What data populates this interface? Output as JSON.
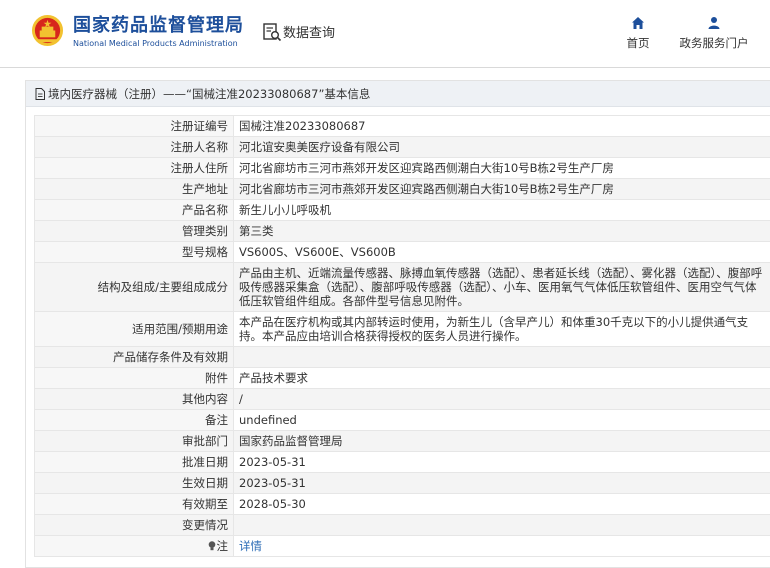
{
  "header": {
    "brand_cn": "国家药品监督管理局",
    "brand_en": "National Medical Products Administration",
    "query_label": "数据查询",
    "nav_home": "首页",
    "nav_portal": "政务服务门户",
    "brand_color": "#1d4f9b"
  },
  "breadcrumb": {
    "text": "境内医疗器械（注册）——“国械注准20233080687”基本信息"
  },
  "rows": [
    {
      "label": "注册证编号",
      "value": "国械注准20233080687"
    },
    {
      "label": "注册人名称",
      "value": "河北谊安奥美医疗设备有限公司"
    },
    {
      "label": "注册人住所",
      "value": "河北省廊坊市三河市燕郊开发区迎宾路西侧潮白大街10号B栋2号生产厂房"
    },
    {
      "label": "生产地址",
      "value": "河北省廊坊市三河市燕郊开发区迎宾路西侧潮白大街10号B栋2号生产厂房"
    },
    {
      "label": "产品名称",
      "value": "新生儿小儿呼吸机"
    },
    {
      "label": "管理类别",
      "value": "第三类"
    },
    {
      "label": "型号规格",
      "value": "VS600S、VS600E、VS600B"
    },
    {
      "label": "结构及组成/主要组成成分",
      "value": "产品由主机、近端流量传感器、脉搏血氧传感器（选配）、患者延长线（选配）、雾化器（选配）、腹部呼吸传感器采集盒（选配）、腹部呼吸传感器（选配）、小车、医用氧气气体低压软管组件、医用空气气体低压软管组件组成。各部件型号信息见附件。"
    },
    {
      "label": "适用范围/预期用途",
      "value": "本产品在医疗机构或其内部转运时使用，为新生儿（含早产儿）和体重30千克以下的小儿提供通气支持。本产品应由培训合格获得授权的医务人员进行操作。"
    },
    {
      "label": "产品储存条件及有效期",
      "value": ""
    },
    {
      "label": "附件",
      "value": "产品技术要求"
    },
    {
      "label": "其他内容",
      "value": "/"
    },
    {
      "label": "备注",
      "value": "undefined"
    },
    {
      "label": "审批部门",
      "value": "国家药品监督管理局"
    },
    {
      "label": "批准日期",
      "value": "2023-05-31"
    },
    {
      "label": "生效日期",
      "value": "2023-05-31"
    },
    {
      "label": "有效期至",
      "value": "2028-05-30"
    },
    {
      "label": "变更情况",
      "value": ""
    },
    {
      "label": "注",
      "value": "详情"
    }
  ]
}
